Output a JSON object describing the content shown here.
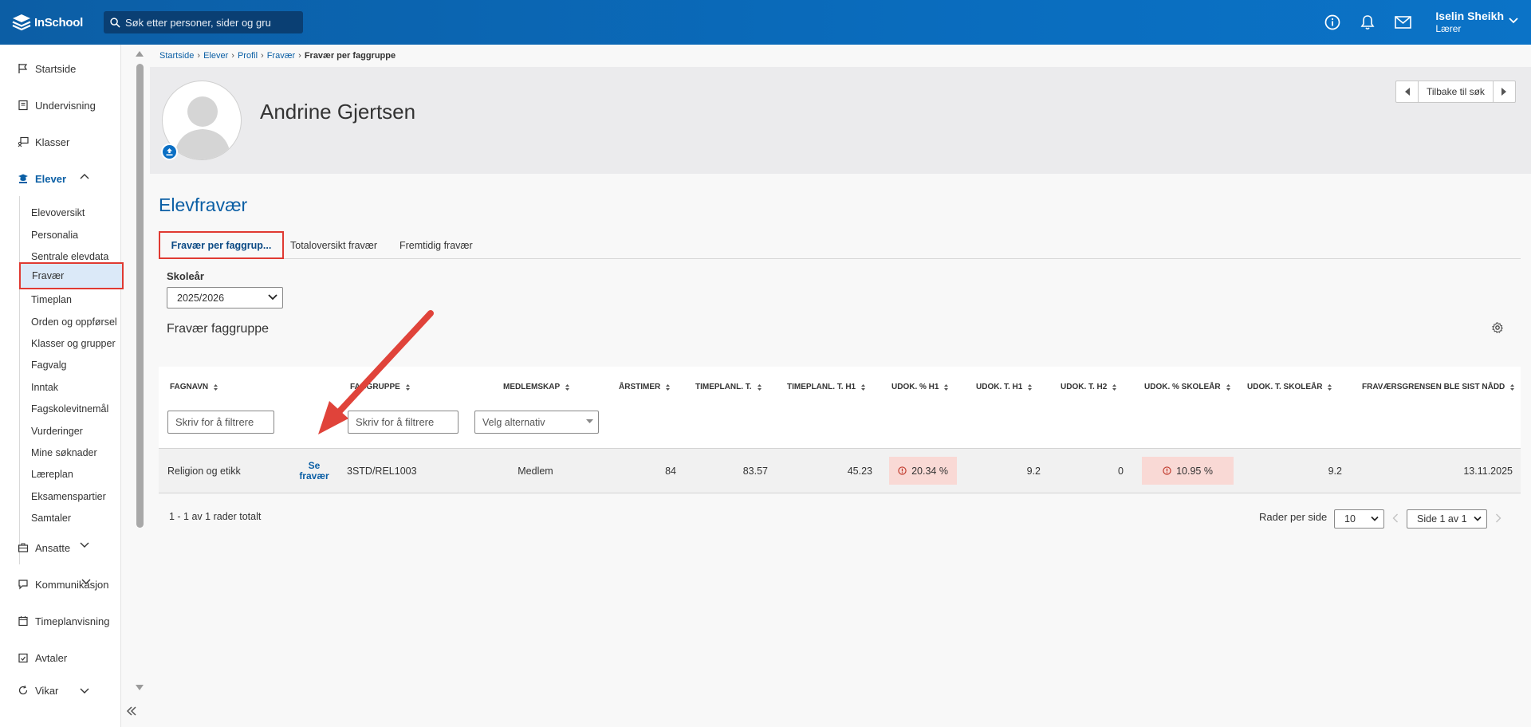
{
  "app": {
    "logo_text": "InSchool",
    "search_placeholder": "Søk etter personer, sider og gru",
    "user_name": "Iselin Sheikh",
    "user_role": "Lærer"
  },
  "sidebar": {
    "items": [
      {
        "label": "Startside",
        "icon": "flag-icon"
      },
      {
        "label": "Undervisning",
        "icon": "book-icon"
      },
      {
        "label": "Klasser",
        "icon": "chalkboard-icon"
      },
      {
        "label": "Elever",
        "icon": "graduation-cap-icon"
      },
      {
        "label": "Ansatte",
        "icon": "briefcase-icon"
      },
      {
        "label": "Kommunikasjon",
        "icon": "chat-icon"
      },
      {
        "label": "Timeplanvisning",
        "icon": "calendar-icon"
      },
      {
        "label": "Avtaler",
        "icon": "calendar-check-icon"
      },
      {
        "label": "Vikar",
        "icon": "refresh-icon"
      }
    ],
    "sub_items": [
      "Elevoversikt",
      "Personalia",
      "Sentrale elevdata",
      "Fravær",
      "Timeplan",
      "Orden og oppførsel",
      "Klasser og grupper",
      "Fagvalg",
      "Inntak",
      "Fagskolevitnemål",
      "Vurderinger",
      "Mine søknader",
      "Læreplan",
      "Eksamenspartier",
      "Samtaler"
    ]
  },
  "breadcrumb": [
    "Startside",
    "Elever",
    "Profil",
    "Fravær",
    "Fravær per faggruppe"
  ],
  "profile": {
    "name": "Andrine Gjertsen",
    "back_label": "Tilbake til søk"
  },
  "page": {
    "heading": "Elevfravær",
    "tabs": [
      "Fravær per faggrup...",
      "Totaloversikt fravær",
      "Fremtidig fravær"
    ],
    "skolear_label": "Skoleår",
    "skolear_value": "2025/2026",
    "section_title": "Fravær faggruppe"
  },
  "table": {
    "headers": [
      "Fagnavn",
      "Faggruppe",
      "Medlemskap",
      "Årstimer",
      "Timeplanl. T.",
      "Timeplanl. T. H1",
      "Udok. % H1",
      "Udok. T. H1",
      "Udok. T. H2",
      "Udok. % Skoleår",
      "Udok. T. Skoleår",
      "Fraværsgrensen ble sist nådd"
    ],
    "filter_placeholder": "Skriv for å filtrere",
    "select_placeholder": "Velg alternativ",
    "row": {
      "fagnavn": "Religion og etikk",
      "link_line1": "Se",
      "link_line2": "fravær",
      "faggruppe": "3STD/REL1003",
      "medlemskap": "Medlem",
      "arstimer": "84",
      "timeplanl_t": "83.57",
      "timeplanl_t_h1": "45.23",
      "udok_pct_h1": "20.34 %",
      "udok_t_h1": "9.2",
      "udok_t_h2": "0",
      "udok_pct_skolear": "10.95 %",
      "udok_t_skolear": "9.2",
      "fravarsgrense_dato": "13.11.2025"
    }
  },
  "pagination": {
    "rows_total": "1 - 1 av 1 rader totalt",
    "rows_per_page_label": "Rader per side",
    "rows_per_page_value": "10",
    "page_value": "Side 1 av 1"
  },
  "colors": {
    "brand": "#0b5fa5",
    "highlight": "#e03a32",
    "warning_bg": "#f9d9d5"
  }
}
